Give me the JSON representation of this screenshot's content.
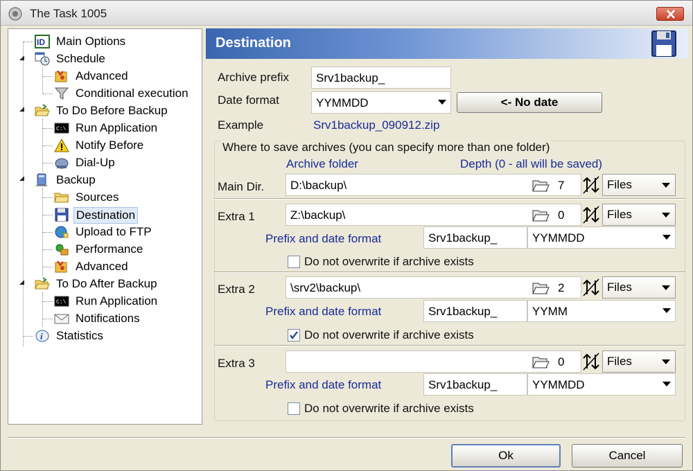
{
  "window": {
    "title": "The Task 1005"
  },
  "tree": {
    "items": [
      {
        "label": "Main Options",
        "icon": "id-icon"
      },
      {
        "label": "Schedule",
        "icon": "calendar-clock-icon"
      },
      {
        "label": "Advanced",
        "icon": "advanced-icon"
      },
      {
        "label": "Conditional execution",
        "icon": "filter-icon"
      },
      {
        "label": "To Do Before Backup",
        "icon": "folder-open-icon"
      },
      {
        "label": "Run Application",
        "icon": "console-icon"
      },
      {
        "label": "Notify Before",
        "icon": "warning-icon"
      },
      {
        "label": "Dial-Up",
        "icon": "dialup-icon"
      },
      {
        "label": "Backup",
        "icon": "computer-icon"
      },
      {
        "label": "Sources",
        "icon": "folder-icon"
      },
      {
        "label": "Destination",
        "icon": "floppy-icon"
      },
      {
        "label": "Upload to FTP",
        "icon": "globe-icon"
      },
      {
        "label": "Performance",
        "icon": "performance-icon"
      },
      {
        "label": "Advanced",
        "icon": "advanced-icon"
      },
      {
        "label": "To Do After Backup",
        "icon": "folder-open-icon"
      },
      {
        "label": "Run Application",
        "icon": "console-icon"
      },
      {
        "label": "Notifications",
        "icon": "envelope-icon"
      },
      {
        "label": "Statistics",
        "icon": "info-icon"
      }
    ]
  },
  "panel": {
    "title": "Destination",
    "archive_prefix_label": "Archive prefix",
    "archive_prefix_value": "Srv1backup_",
    "date_format_label": "Date format",
    "date_format_value": "YYMMDD",
    "no_date_button": "<- No date",
    "example_label": "Example",
    "example_value": "Srv1backup_090912.zip",
    "where_label": "Where to save archives (you can specify more than one folder)",
    "archive_folder_header": "Archive folder",
    "depth_header": "Depth (0 - all will be saved)",
    "prefix_date_label": "Prefix and date format",
    "overwrite_label": "Do not overwrite if archive exists",
    "main": {
      "label": "Main Dir.",
      "path": "D:\\backup\\",
      "depth": "7",
      "mode": "Files"
    },
    "extras": [
      {
        "label": "Extra 1",
        "path": "Z:\\backup\\",
        "depth": "0",
        "mode": "Files",
        "prefix": "Srv1backup_",
        "date_format": "YYMMDD",
        "no_overwrite": false
      },
      {
        "label": "Extra 2",
        "path": "\\srv2\\backup\\",
        "depth": "2",
        "mode": "Files",
        "prefix": "Srv1backup_",
        "date_format": "YYMM",
        "no_overwrite": true
      },
      {
        "label": "Extra 3",
        "path": "",
        "depth": "0",
        "mode": "Files",
        "prefix": "Srv1backup_",
        "date_format": "YYMMDD",
        "no_overwrite": false
      }
    ]
  },
  "footer": {
    "ok": "Ok",
    "cancel": "Cancel"
  }
}
